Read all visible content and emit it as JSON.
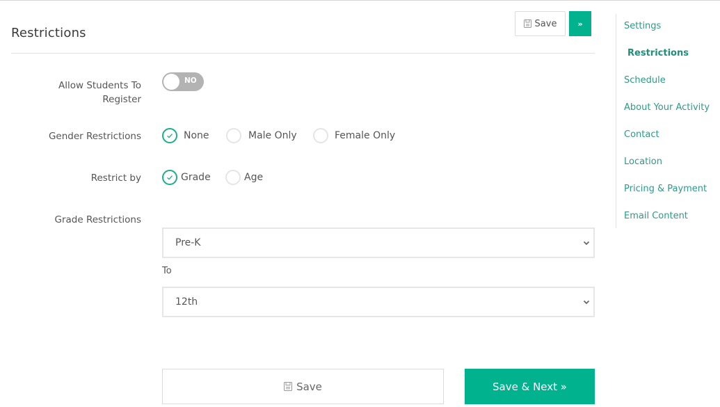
{
  "page": {
    "title": "Restrictions"
  },
  "toolbar": {
    "save_label": "Save",
    "next_label": "»"
  },
  "form": {
    "allow_register": {
      "label": "Allow Students To Register",
      "label_line1": "Allow Students To",
      "label_line2": "Register",
      "toggle_text": "NO",
      "value": false
    },
    "gender": {
      "label": "Gender Restrictions",
      "options": [
        {
          "label": "None",
          "checked": true
        },
        {
          "label": "Male Only",
          "checked": false
        },
        {
          "label": "Female Only",
          "checked": false
        }
      ]
    },
    "restrict_by": {
      "label": "Restrict by",
      "options": [
        {
          "label": "Grade",
          "checked": true
        },
        {
          "label": "Age",
          "checked": false
        }
      ]
    },
    "grade": {
      "label": "Grade Restrictions",
      "from_value": "Pre-K",
      "to_label": "To",
      "to_value": "12th"
    }
  },
  "footer": {
    "save_label": "Save",
    "save_next_label": "Save & Next »"
  },
  "sidenav": {
    "items": [
      {
        "label": "Settings",
        "active": false
      },
      {
        "label": "Restrictions",
        "active": true
      },
      {
        "label": "Schedule",
        "active": false
      },
      {
        "label": "About Your Activity",
        "active": false
      },
      {
        "label": "Contact",
        "active": false
      },
      {
        "label": "Location",
        "active": false
      },
      {
        "label": "Pricing & Payment",
        "active": false
      },
      {
        "label": "Email Content",
        "active": false
      }
    ]
  },
  "colors": {
    "accent": "#00b28e",
    "nav_link": "#2c9b87",
    "toggle_off": "#b3b3b3"
  }
}
